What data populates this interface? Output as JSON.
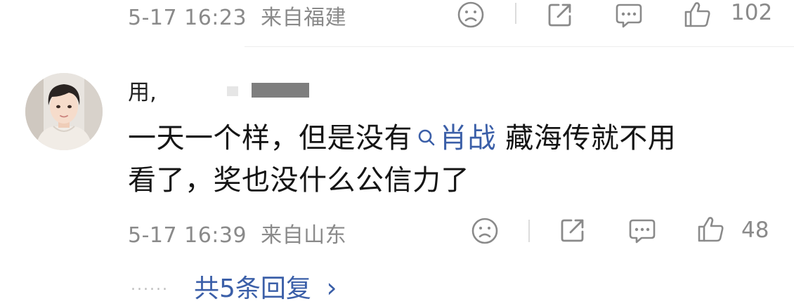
{
  "prev_comment": {
    "timestamp": "5-17 16:23",
    "location": "来自福建",
    "like_count": "102"
  },
  "comment": {
    "username": "用,",
    "content_line1_before": "一天一个样，但是没有",
    "topic": "肖战",
    "content_line1_after": " 藏海传就不用",
    "content_line2": "看了，奖也没什么公信力了",
    "timestamp": "5-17 16:39",
    "location": "来自山东",
    "like_count": "48"
  },
  "replies": {
    "dots": "......",
    "label": "共5条回复",
    "chevron": "›"
  },
  "icons": {
    "dislike": "sad-face-icon",
    "share": "share-icon",
    "comment": "comment-icon",
    "like": "thumbs-up-icon",
    "topic": "search-icon"
  },
  "colors": {
    "link": "#3b5fa8",
    "meta": "#8a8a8a",
    "text": "#151515"
  }
}
